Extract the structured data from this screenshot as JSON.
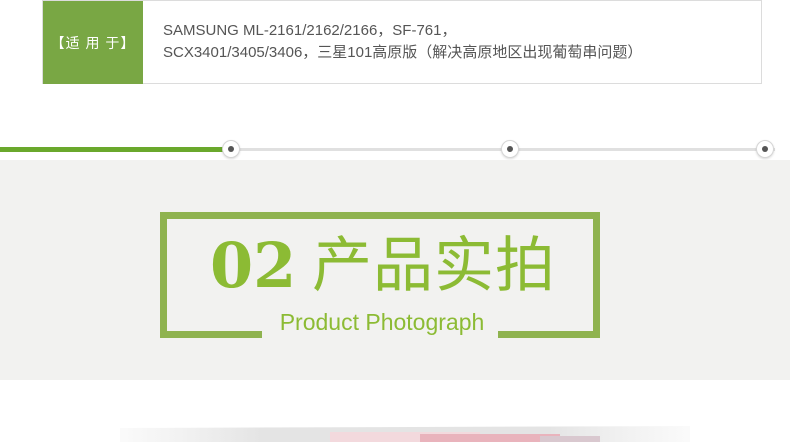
{
  "info": {
    "label": "【适 用 于】",
    "text_line1": "SAMSUNG ML-2161/2162/2166，SF-761，",
    "text_line2": "SCX3401/3405/3406，三星101高原版（解决高原地区出现葡萄串问题）"
  },
  "section": {
    "number": "02",
    "title": "产品实拍",
    "subtitle": "Product Photograph"
  },
  "colors": {
    "label_bg": "#79a744",
    "accent_green": "#8cbb34",
    "frame_green": "#8fb34f",
    "divider_green": "#6aa82c",
    "panel_bg": "#f2f2f0"
  }
}
